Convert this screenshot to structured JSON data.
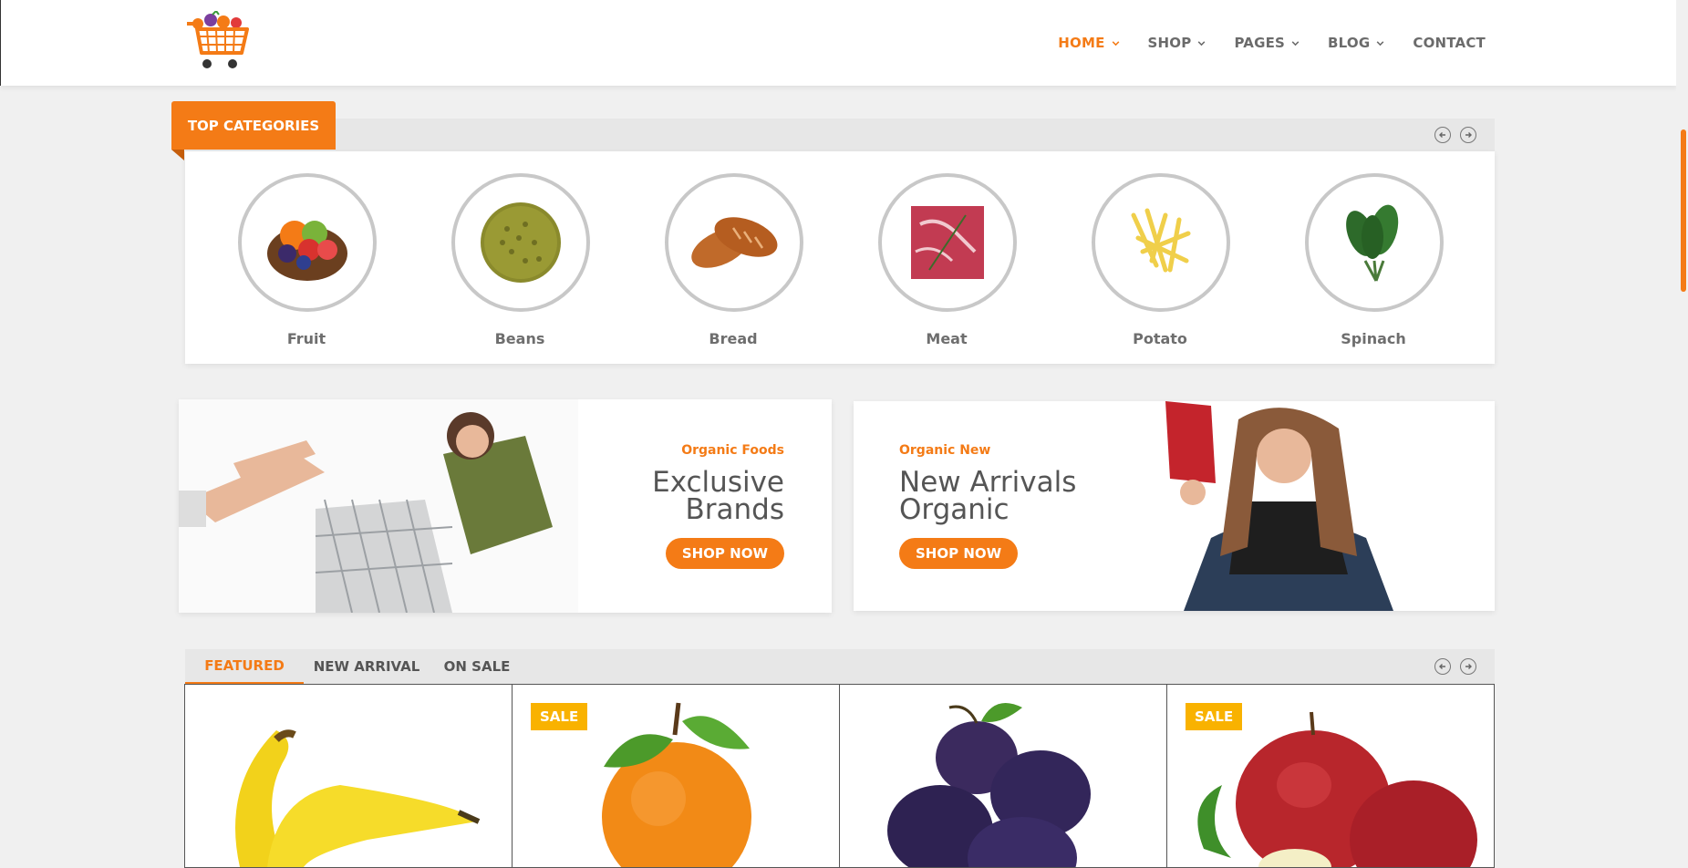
{
  "header": {
    "nav": [
      {
        "label": "HOME",
        "active": true,
        "has_dropdown": true
      },
      {
        "label": "SHOP",
        "active": false,
        "has_dropdown": true
      },
      {
        "label": "PAGES",
        "active": false,
        "has_dropdown": true
      },
      {
        "label": "BLOG",
        "active": false,
        "has_dropdown": true
      },
      {
        "label": "CONTACT",
        "active": false,
        "has_dropdown": false
      }
    ]
  },
  "top_categories": {
    "title": "TOP CATEGORIES",
    "items": [
      {
        "label": "Fruit",
        "icon": "fruit-basket-icon"
      },
      {
        "label": "Beans",
        "icon": "beans-icon"
      },
      {
        "label": "Bread",
        "icon": "bread-icon"
      },
      {
        "label": "Meat",
        "icon": "meat-icon"
      },
      {
        "label": "Potato",
        "icon": "potato-fries-icon"
      },
      {
        "label": "Spinach",
        "icon": "spinach-icon"
      }
    ]
  },
  "banners": [
    {
      "subtitle": "Organic Foods",
      "title_line1": "Exclusive",
      "title_line2": "Brands",
      "button": "SHOP NOW"
    },
    {
      "subtitle": "Organic New",
      "title_line1": "New Arrivals",
      "title_line2": "Organic",
      "button": "SHOP NOW"
    }
  ],
  "product_tabs": {
    "tabs": [
      {
        "label": "FEATURED",
        "active": true
      },
      {
        "label": "NEW ARRIVAL",
        "active": false
      },
      {
        "label": "ON SALE",
        "active": false
      }
    ]
  },
  "products": [
    {
      "name": "banana",
      "sale": false
    },
    {
      "name": "orange",
      "sale": true,
      "badge": "SALE"
    },
    {
      "name": "plum",
      "sale": false
    },
    {
      "name": "apple",
      "sale": true,
      "badge": "SALE"
    }
  ],
  "colors": {
    "accent": "#f47b16",
    "sale_badge": "#f9b200",
    "background": "#f0f0f0"
  }
}
